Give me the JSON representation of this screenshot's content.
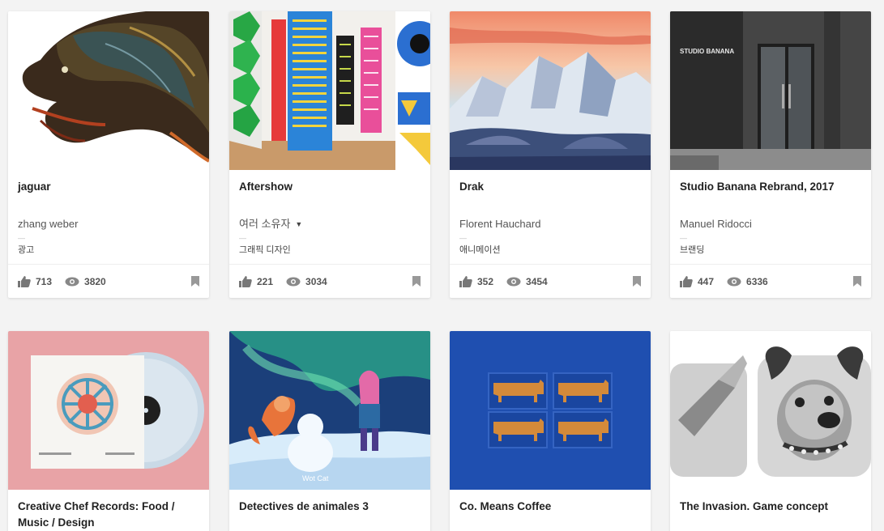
{
  "cards": [
    {
      "title": "jaguar",
      "owner": "zhang weber",
      "owner_has_caret": false,
      "separator": "—",
      "field": "광고",
      "likes": "713",
      "views": "3820"
    },
    {
      "title": "Aftershow",
      "owner": "여러 소유자",
      "owner_has_caret": true,
      "separator": "—",
      "field": "그래픽 디자인",
      "likes": "221",
      "views": "3034"
    },
    {
      "title": "Drak",
      "owner": "Florent Hauchard",
      "owner_has_caret": false,
      "separator": "—",
      "field": "애니메이션",
      "likes": "352",
      "views": "3454"
    },
    {
      "title": "Studio Banana Rebrand, 2017",
      "owner": "Manuel Ridocci",
      "owner_has_caret": false,
      "separator": "—",
      "field": "브랜딩",
      "likes": "447",
      "views": "6336"
    },
    {
      "title": "Creative Chef Records: Food / Music / Design"
    },
    {
      "title": "Detectives de animales 3"
    },
    {
      "title": "Co. Means Coffee"
    },
    {
      "title": "The Invasion. Game concept"
    }
  ],
  "image_text": {
    "studio_sign": "STUDIO BANANA",
    "detectives_caption": "Wot Cat"
  },
  "icons": {
    "like": "thumbs-up-icon",
    "view": "eye-icon",
    "save": "bookmark-icon",
    "caret": "caret-down-icon"
  },
  "colors": {
    "card_bg": "#ffffff",
    "page_bg": "#f3f3f3",
    "coffee_blue": "#1f4fb0",
    "records_pink": "#e8a3a6"
  }
}
